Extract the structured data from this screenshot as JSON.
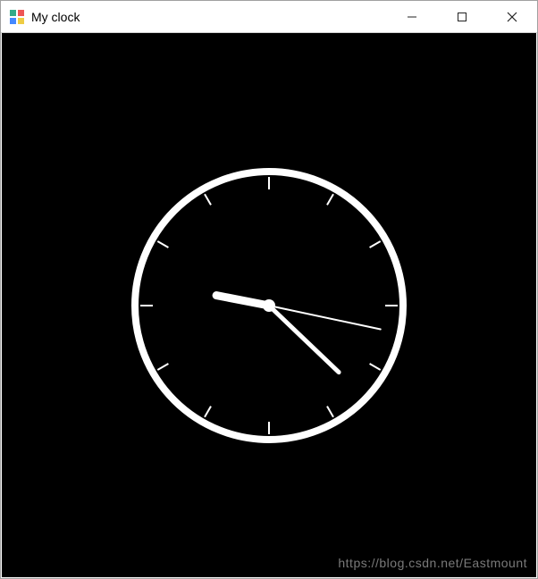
{
  "window": {
    "title": "My clock",
    "controls": {
      "minimize": "minimize-icon",
      "maximize": "maximize-icon",
      "close": "close-icon"
    }
  },
  "clock": {
    "face_bg": "#000000",
    "stroke": "#ffffff",
    "radius": 150,
    "ring_width": 8,
    "tick_count": 12,
    "hour": 9,
    "minute": 22,
    "second": 17
  },
  "watermark": {
    "text": "https://blog.csdn.net/Eastmount"
  }
}
